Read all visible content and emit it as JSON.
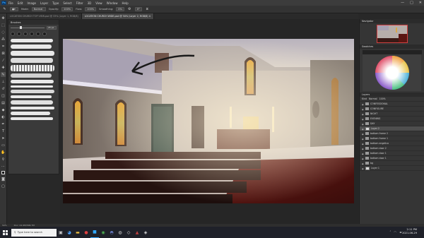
{
  "app": {
    "logo": "Ps"
  },
  "menubar": {
    "items": [
      "File",
      "Edit",
      "Image",
      "Layer",
      "Type",
      "Select",
      "Filter",
      "3D",
      "View",
      "Window",
      "Help"
    ],
    "window_controls": [
      "—",
      "□",
      "✕"
    ]
  },
  "options": {
    "mode_label": "Mode:",
    "mode_value": "Normal",
    "opacity_label": "Opacity:",
    "opacity_value": "100%",
    "flow_label": "Flow:",
    "flow_value": "100%",
    "smoothing_label": "Smoothing:",
    "smoothing_value": "0%",
    "angle_value": "0°"
  },
  "tabs": [
    {
      "label": "LOCATION CHURCH TOP VIEW.psd @ 33% (Layer 1, RGB/8)",
      "active": false
    },
    {
      "label": "LOCATION CHURCH WIDE.psd @ 50% (Layer 2, RGB/8) ✕",
      "active": true
    }
  ],
  "brushes": {
    "title": "Brushes",
    "size_value": "25 px",
    "presets_count": 6
  },
  "right": {
    "navigator_title": "Navigator",
    "swatches_title": "Swatches",
    "layers_title": "Layers",
    "kind_label": "Kind",
    "blend_mode": "Normal",
    "opacity_value": "100%",
    "layers": [
      {
        "name": "CONFESSIONAL",
        "type": "folder",
        "selected": false
      },
      {
        "name": "CONFIGURE",
        "type": "folder",
        "selected": false
      },
      {
        "name": "NIGHT",
        "type": "folder",
        "selected": false
      },
      {
        "name": "EVENING",
        "type": "folder",
        "selected": false
      },
      {
        "name": "DAY",
        "type": "folder",
        "selected": false
      },
      {
        "name": "Layer 2",
        "type": "layer",
        "selected": true
      },
      {
        "name": "bottom frame 2",
        "type": "folder",
        "selected": false
      },
      {
        "name": "bottom frame 1",
        "type": "folder",
        "selected": false
      },
      {
        "name": "bottom angelica",
        "type": "folder",
        "selected": false
      },
      {
        "name": "bottom door 2",
        "type": "folder",
        "selected": false
      },
      {
        "name": "bottom door 1",
        "type": "folder",
        "selected": false
      },
      {
        "name": "bottom door 1",
        "type": "folder",
        "selected": false
      },
      {
        "name": "bg",
        "type": "folder",
        "selected": false
      },
      {
        "name": "Layer 1",
        "type": "layer",
        "selected": false
      }
    ]
  },
  "status": {
    "zoom": "50%",
    "doc_info": "Doc: 24.9M/306.7M"
  },
  "taskbar": {
    "search_placeholder": "Type here to search",
    "time": "2:11 PM",
    "date": "2021-06-29"
  },
  "colors": {
    "ps_blue": "#31a8ff",
    "layer_selected": "#4e4e4e",
    "taskbar": "#1f2129"
  }
}
